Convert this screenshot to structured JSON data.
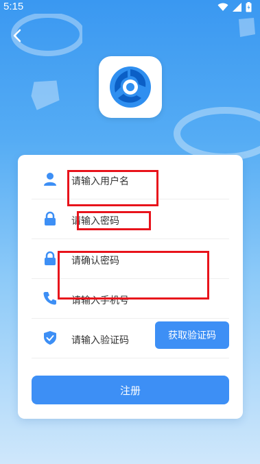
{
  "status": {
    "time": "5:15"
  },
  "form": {
    "username_placeholder": "请输入用户名",
    "password_placeholder": "请输入密码",
    "confirm_password_placeholder": "请确认密码",
    "phone_placeholder": "请输入手机号",
    "code_placeholder": "请输入验证码",
    "get_code_label": "获取验证码",
    "register_label": "注册"
  },
  "icons": {
    "back": "back-arrow-icon",
    "user": "user-icon",
    "lock": "lock-icon",
    "phone": "phone-icon",
    "shield": "shield-check-icon"
  },
  "colors": {
    "accent": "#3d8ff5",
    "highlight": "#e8131b"
  }
}
